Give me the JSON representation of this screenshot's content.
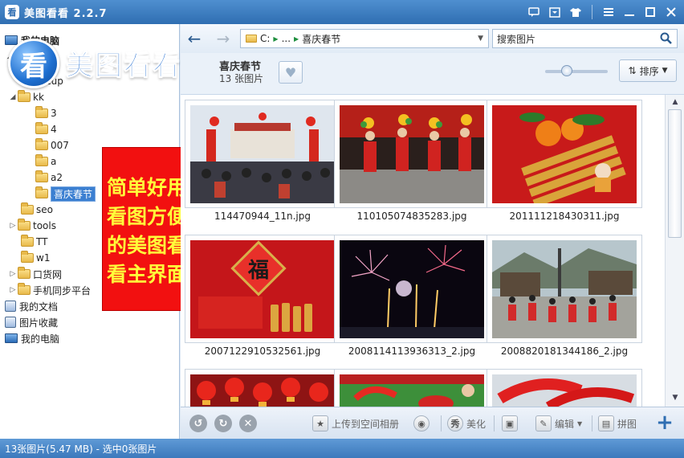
{
  "app": {
    "logo_glyph": "看",
    "title": "美图看看 2.2.7"
  },
  "titlebar_icons": [
    "chat-icon",
    "skin-icon",
    "shirt-icon",
    "menu-icon",
    "minimize-icon",
    "maximize-icon",
    "close-icon"
  ],
  "tree": {
    "root_label": "我的电脑",
    "folders": [
      {
        "label": "cup"
      },
      {
        "label": "kk",
        "children": [
          "3",
          "4",
          "007",
          "a",
          "a2",
          "喜庆春节"
        ]
      },
      {
        "label": "seo"
      },
      {
        "label": "tools"
      },
      {
        "label": "TT"
      },
      {
        "label": "w1"
      },
      {
        "label": "口货网"
      },
      {
        "label": "手机同步平台"
      }
    ],
    "system": [
      "我的文档",
      "图片收藏",
      "我的电脑"
    ]
  },
  "logo_overlay": {
    "circle_glyph": "看",
    "text": "美图看看"
  },
  "promo": {
    "lines": [
      "简单好用",
      "看图方便",
      "的美图看",
      "看主界面"
    ],
    "bg_color": "#f21010",
    "text_color": "#fffd3a"
  },
  "nav": {
    "back_glyph": "←",
    "forward_glyph": "→",
    "path": {
      "drive": "C:",
      "ellipsis": "...",
      "current": "喜庆春节"
    },
    "search_placeholder": "搜索图片"
  },
  "folder_header": {
    "title": "喜庆春节",
    "count": "13 张图片",
    "sort_label": "排序"
  },
  "zoom": {
    "level": 0.35
  },
  "thumbnails": [
    {
      "name": "114470944_11n.jpg",
      "scene": "crowd-gate"
    },
    {
      "name": "110105074835283.jpg",
      "scene": "dancing-kids"
    },
    {
      "name": "201111218430311.jpg",
      "scene": "firecrackers-oranges"
    },
    {
      "name": "2007122910532561.jpg",
      "scene": "fu-couplets"
    },
    {
      "name": "2008114113936313_2.jpg",
      "scene": "fireworks-night"
    },
    {
      "name": "2008820181344186_2.jpg",
      "scene": "village-dance"
    },
    {
      "name": "",
      "scene": "lanterns"
    },
    {
      "name": "",
      "scene": "drums"
    },
    {
      "name": "",
      "scene": "red-ribbons"
    }
  ],
  "bottom_toolbar": {
    "upload_label": "上传到空间相册",
    "beautify_label": "美化",
    "edit_label": "编辑",
    "collage_label": "拼图",
    "beautify_glyph": "秀"
  },
  "status": {
    "text": "13张图片(5.47 MB) - 选中0张图片"
  }
}
